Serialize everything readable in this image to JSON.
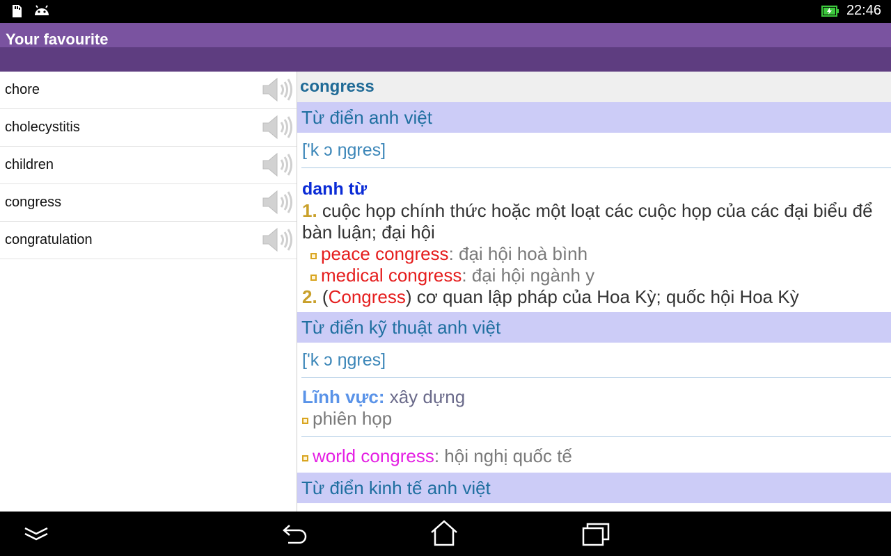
{
  "status": {
    "time": "22:46",
    "icons": [
      "sd-card-icon",
      "android-icon",
      "battery-charging-icon"
    ]
  },
  "app": {
    "title": "Your favourite"
  },
  "favourites": [
    {
      "word": "chore"
    },
    {
      "word": "cholecystitis"
    },
    {
      "word": "children"
    },
    {
      "word": "congress"
    },
    {
      "word": "congratulation"
    }
  ],
  "entry": {
    "headword": "congress",
    "sec1": {
      "title": "Từ điển anh việt",
      "phonetic": "['k ɔ ŋgres]",
      "pos": "danh từ",
      "def1_num": "1.",
      "def1_text": " cuộc họp chính thức hoặc một loạt các cuộc họp của các đại biểu để bàn luận; đại hội",
      "ex1_term": "peace congress",
      "ex1_meaning": ": đại hội hoà bình",
      "ex2_term": "medical congress",
      "ex2_meaning": ": đại hội ngành y",
      "def2_num": "2.",
      "def2_open": " (",
      "def2_term": "Congress",
      "def2_rest": ") cơ quan lập pháp của Hoa Kỳ; quốc hội Hoa Kỳ"
    },
    "sec2": {
      "title": "Từ điển kỹ thuật anh việt",
      "phonetic": "['k ɔ ŋgres]",
      "field_label": "Lĩnh vực:",
      "field_value": " xây dựng",
      "meaning1": "phiên họp",
      "term2": "world congress",
      "meaning2": ": hội nghị quốc tế"
    },
    "sec3": {
      "title": "Từ điển kinh tế anh việt"
    }
  },
  "navbar": {
    "icons": [
      "hide-keyboard-icon",
      "back-icon",
      "home-icon",
      "recent-apps-icon"
    ]
  }
}
